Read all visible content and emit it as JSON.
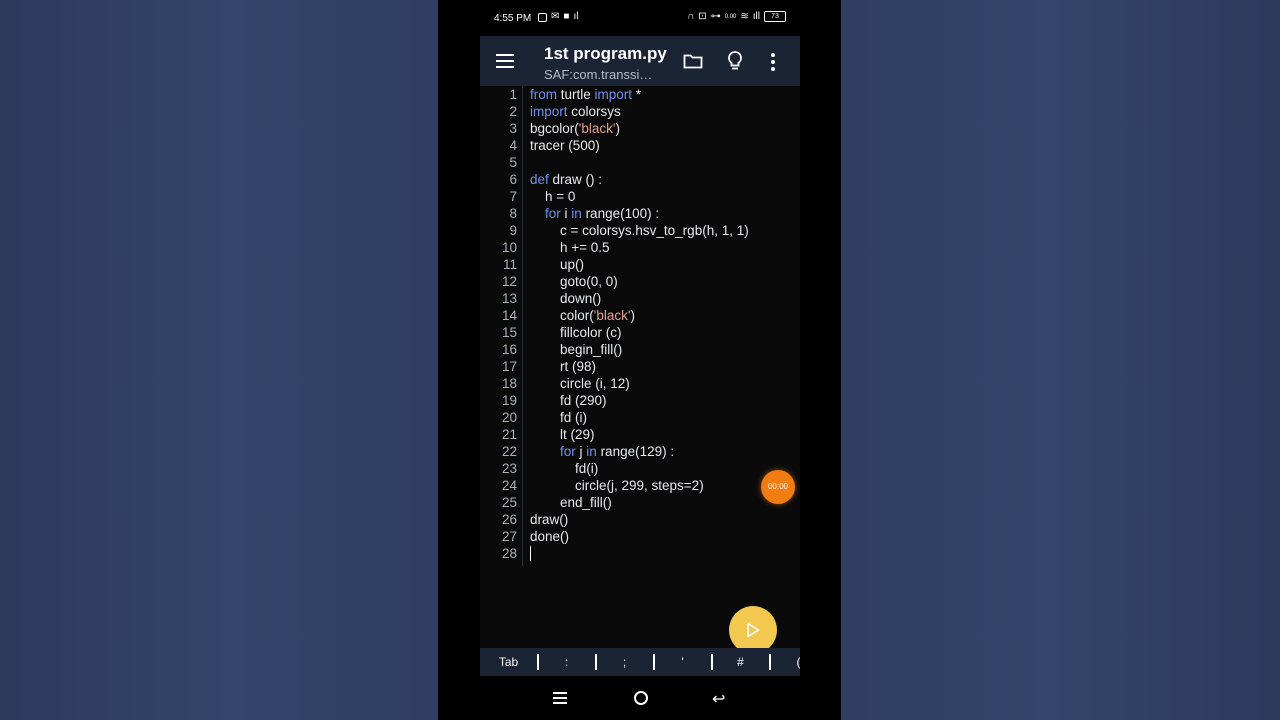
{
  "status_bar": {
    "time": "4:55 PM",
    "battery": "73",
    "network_speed": "0.00"
  },
  "app_bar": {
    "title": "1st program.py",
    "subtitle": "SAF:com.transsi…"
  },
  "code_lines": [
    {
      "n": "1",
      "segs": [
        {
          "t": "from",
          "k": "kw"
        },
        {
          "t": " turtle "
        },
        {
          "t": "import",
          "k": "kw"
        },
        {
          "t": " *"
        }
      ]
    },
    {
      "n": "2",
      "segs": [
        {
          "t": "import",
          "k": "kw"
        },
        {
          "t": " colorsys"
        }
      ]
    },
    {
      "n": "3",
      "segs": [
        {
          "t": "bgcolor("
        },
        {
          "t": "'black'",
          "k": "str"
        },
        {
          "t": ")"
        }
      ]
    },
    {
      "n": "4",
      "segs": [
        {
          "t": "tracer (500)"
        }
      ]
    },
    {
      "n": "5",
      "segs": []
    },
    {
      "n": "6",
      "segs": [
        {
          "t": "def",
          "k": "kw"
        },
        {
          "t": " draw () :"
        }
      ]
    },
    {
      "n": "7",
      "segs": [
        {
          "t": "    h = 0"
        }
      ]
    },
    {
      "n": "8",
      "segs": [
        {
          "t": "    "
        },
        {
          "t": "for",
          "k": "kw"
        },
        {
          "t": " i "
        },
        {
          "t": "in",
          "k": "kw"
        },
        {
          "t": " range(100) :"
        }
      ]
    },
    {
      "n": "9",
      "segs": [
        {
          "t": "        c = colorsys.hsv_to_rgb(h, 1, 1)"
        }
      ]
    },
    {
      "n": "10",
      "segs": [
        {
          "t": "        h += 0.5"
        }
      ]
    },
    {
      "n": "11",
      "segs": [
        {
          "t": "        up()"
        }
      ]
    },
    {
      "n": "12",
      "segs": [
        {
          "t": "        goto(0, 0)"
        }
      ]
    },
    {
      "n": "13",
      "segs": [
        {
          "t": "        down()"
        }
      ]
    },
    {
      "n": "14",
      "segs": [
        {
          "t": "        color("
        },
        {
          "t": "'black'",
          "k": "str"
        },
        {
          "t": ")"
        }
      ]
    },
    {
      "n": "15",
      "segs": [
        {
          "t": "        fillcolor (c)"
        }
      ]
    },
    {
      "n": "16",
      "segs": [
        {
          "t": "        begin_fill()"
        }
      ]
    },
    {
      "n": "17",
      "segs": [
        {
          "t": "        rt (98)"
        }
      ]
    },
    {
      "n": "18",
      "segs": [
        {
          "t": "        circle (i, 12)"
        }
      ]
    },
    {
      "n": "19",
      "segs": [
        {
          "t": "        fd (290)"
        }
      ]
    },
    {
      "n": "20",
      "segs": [
        {
          "t": "        fd (i)"
        }
      ]
    },
    {
      "n": "21",
      "segs": [
        {
          "t": "        lt (29)"
        }
      ]
    },
    {
      "n": "22",
      "segs": [
        {
          "t": "        "
        },
        {
          "t": "for",
          "k": "kw"
        },
        {
          "t": " j "
        },
        {
          "t": "in",
          "k": "kw"
        },
        {
          "t": " range(129) :"
        }
      ]
    },
    {
      "n": "23",
      "segs": [
        {
          "t": "            fd(i)"
        }
      ]
    },
    {
      "n": "24",
      "segs": [
        {
          "t": "            circle(j, 299, steps=2)"
        }
      ]
    },
    {
      "n": "25",
      "segs": [
        {
          "t": "        end_fill()"
        }
      ]
    },
    {
      "n": "26",
      "segs": [
        {
          "t": "draw()"
        }
      ]
    },
    {
      "n": "27",
      "segs": [
        {
          "t": "done()"
        }
      ]
    },
    {
      "n": "28",
      "segs": []
    }
  ],
  "timer": {
    "label": "00:00"
  },
  "key_bar": [
    "Tab",
    ":",
    ";",
    "'",
    "#",
    "("
  ],
  "colors": {
    "keyword": "#6f8ff0",
    "string": "#e2a08e",
    "appbar": "#1b2435",
    "fab": "#f3c84f",
    "timer": "#f07c12"
  }
}
